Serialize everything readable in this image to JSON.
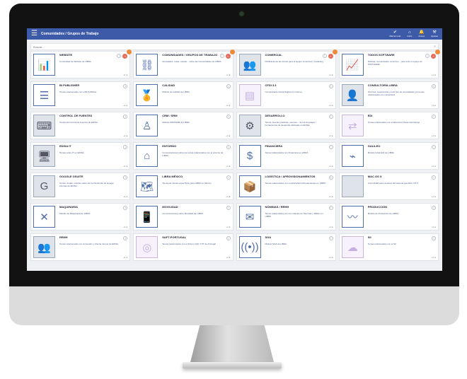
{
  "app": {
    "title": "Comunidades / Grupos de Trabajo",
    "menu_icon": "hamburger-icon",
    "actions": [
      {
        "label": "Marcar todo",
        "icon": "check-icon",
        "glyph": "✔"
      },
      {
        "label": "Inicio",
        "icon": "home-icon",
        "glyph": "⌂"
      },
      {
        "label": "Avisos",
        "icon": "bell-icon",
        "glyph": "🔔"
      },
      {
        "label": "Ajustes",
        "icon": "tools-icon",
        "glyph": "⚒"
      }
    ]
  },
  "search": {
    "placeholder": "Buscar..."
  },
  "colors": {
    "topbar": "#3d5aa8",
    "accent": "#4f6ea9",
    "badge": "#ee8b3b",
    "close": "#e56b5a"
  },
  "cards": [
    {
      "title": "WEBSITE",
      "desc": "Comunidad de Website de LIBRA",
      "icon": "bar-chart-icon",
      "glyph": "📊",
      "badge": true,
      "close": true
    },
    {
      "title": "COMUNIDADES / GRUPOS DE TRABAJO",
      "desc": "Novedades, notas, estado... sobre las Comunidades de LIBRA",
      "icon": "network-icon",
      "glyph": "⛓",
      "badge": true,
      "close": true
    },
    {
      "title": "COMERCIAL",
      "desc": "Publicaciones de interés para el equipo comercial y marketing",
      "icon": "team-icon",
      "glyph": "👥",
      "badge": true,
      "close": true,
      "photo": true
    },
    {
      "title": "TODOS SOFTWARE",
      "desc": "Noticias, comunicados, anuncios... para todo el equipo de SOFTWARE",
      "icon": "city-chart-icon",
      "glyph": "📈",
      "badge": true,
      "close": true
    },
    {
      "title": "BI PUBLISHER",
      "desc": "Temas relacionados con el BI Publisher",
      "icon": "document-icon",
      "glyph": "☰"
    },
    {
      "title": "CALIDAD",
      "desc": "Módulo de Calidad de LIBRA",
      "icon": "certificate-icon",
      "glyph": "🏅"
    },
    {
      "title": "CFDI 3.3",
      "desc": "Comprobante Fiscal Digital por Internet",
      "icon": "cfdi-icon",
      "glyph": "▤",
      "faded": true
    },
    {
      "title": "CONSULTORÍA LIBRA",
      "desc": "Informes, sugerencias y todo tipo de necesidades y/o temas relacionados con consultoría",
      "icon": "consulting-icon",
      "glyph": "👤",
      "photo": true
    },
    {
      "title": "CONTROL DE FUENTES",
      "desc": "Temas del Control de Fuentes de EDISA",
      "icon": "code-control-icon",
      "glyph": "⌨",
      "photo": true
    },
    {
      "title": "CRM / SRM",
      "desc": "Módulo CRM/SRM de LIBRA",
      "icon": "org-chart-icon",
      "glyph": "♙"
    },
    {
      "title": "DESARROLLO",
      "desc": "Temas, buenas prácticas, eventos... de los lenguajes / herramientas de desarrollo utilizadas en EDISA",
      "icon": "developers-icon",
      "glyph": "⚙",
      "photo": true
    },
    {
      "title": "EDI",
      "desc": "Temas relacionados con el Electronic Data Interchange",
      "icon": "edi-icon",
      "glyph": "⇄",
      "faded": true
    },
    {
      "title": "EDISA IT",
      "desc": "Temas sobre IT en EDISA",
      "icon": "it-infra-icon",
      "glyph": "🖥",
      "photo": true
    },
    {
      "title": "ENTORNO",
      "desc": "Comunicaciones sobre los temas relacionados con el entorno de LIBRA",
      "icon": "home-circle-icon",
      "glyph": "⌂"
    },
    {
      "title": "FINANCIERA",
      "desc": "Temas relacionados con Financiera en LIBRA",
      "icon": "dollar-icon",
      "glyph": "$"
    },
    {
      "title": "GALILEO",
      "desc": "Módulo GALILEO de LIBRA",
      "icon": "galileo-icon",
      "glyph": "⌁"
    },
    {
      "title": "GOOGLE GSUITE",
      "desc": "Temas, dudas, noticias sobre las herramientas de Google internas de EDISA",
      "icon": "google-icon",
      "glyph": "G",
      "photo": true
    },
    {
      "title": "LIBRA MÉXICO",
      "desc": "Temas de interés específicos para LIBRA en México",
      "icon": "map-icon",
      "glyph": "🗺"
    },
    {
      "title": "LOGÍSTICA / APROVISIONAMIENTOS",
      "desc": "Temas relacionados con Logística/Aprovisionamientos en LIBRA",
      "icon": "box-icon",
      "glyph": "📦"
    },
    {
      "title": "MAC OS X",
      "desc": "Comunidad para usuarios del sistema operativo OS X",
      "icon": "apple-icon",
      "glyph": "",
      "photo": true
    },
    {
      "title": "MAQUINARIA",
      "desc": "Módulo de Maquinaria de LIBRA",
      "icon": "wrench-icon",
      "glyph": "✕"
    },
    {
      "title": "MOVILIDAD",
      "desc": "Comunicaciones sobre Movilidad de LIBRA",
      "icon": "mobile-icon",
      "glyph": "📱"
    },
    {
      "title": "NÓMINAS / RRHH",
      "desc": "Temas relacionados con los módulos de Nóminas y RRHH en LIBRA",
      "icon": "payroll-icon",
      "glyph": "✉"
    },
    {
      "title": "PRODUCCIÓN",
      "desc": "Módulo de Producción de LIBRA",
      "icon": "production-icon",
      "glyph": "〰"
    },
    {
      "title": "RRHH",
      "desc": "Temas relacionados con la Gestión y Cliente interno de EDISA",
      "icon": "hr-icon",
      "glyph": "👥",
      "photo": true
    },
    {
      "title": "SAFT-PORTUGAL",
      "desc": "Temas relacionados con el fichero SAF-T PT de Portugal",
      "icon": "saft-icon",
      "glyph": "◎",
      "faded": true
    },
    {
      "title": "SGA",
      "desc": "Módulo SGA de LIBRA",
      "icon": "signal-icon",
      "glyph": "((•))"
    },
    {
      "title": "SII",
      "desc": "Temas relacionados con el SII",
      "icon": "sii-icon",
      "glyph": "☁",
      "faded": true
    }
  ],
  "card_common": {
    "info_glyph": "i",
    "close_glyph": "×",
    "meta": "+1 ●"
  }
}
